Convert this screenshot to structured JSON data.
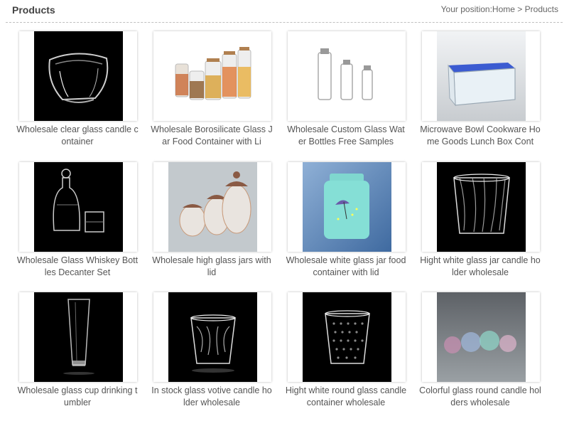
{
  "header": {
    "title": "Products",
    "position_label": "Your position:",
    "home_link": "Home",
    "separator": ">",
    "current": "Products"
  },
  "products": [
    {
      "caption": "Wholesale clear glass candle container",
      "image": "clear-glass-bowl-icon",
      "bg": "#000000"
    },
    {
      "caption": "Wholesale Borosilicate Glass Jar Food Container with Li",
      "image": "food-jars-icon",
      "bg": "#ffffff"
    },
    {
      "caption": "Wholesale Custom Glass Water Bottles Free Samples",
      "image": "water-bottles-icon",
      "bg": "#ffffff"
    },
    {
      "caption": "Microwave Bowl Cookware Home Goods Lunch Box Cont",
      "image": "lunch-box-icon",
      "bg": "#d9dde0"
    },
    {
      "caption": "Wholesale Glass Whiskey Bottles Decanter Set",
      "image": "decanter-set-icon",
      "bg": "#000000"
    },
    {
      "caption": "Wholesale high glass jars with lid",
      "image": "jars-with-lid-icon",
      "bg": "#b9c1c6"
    },
    {
      "caption": "Wholesale white glass jar food container with lid",
      "image": "blue-jar-icon",
      "bg": "#5a84b3"
    },
    {
      "caption": "Hight white glass jar candle holder wholesale",
      "image": "candle-holder-icon",
      "bg": "#000000"
    },
    {
      "caption": "Wholesale glass cup drinking tumbler",
      "image": "tall-tumbler-icon",
      "bg": "#000000"
    },
    {
      "caption": "In stock glass votive candle holder wholesale",
      "image": "votive-holder-icon",
      "bg": "#000000"
    },
    {
      "caption": "Hight white round glass candle container wholesale",
      "image": "dotted-container-icon",
      "bg": "#000000"
    },
    {
      "caption": "Colorful glass round candle holders wholesale",
      "image": "colorful-holders-icon",
      "bg": "#4a4e52"
    }
  ]
}
